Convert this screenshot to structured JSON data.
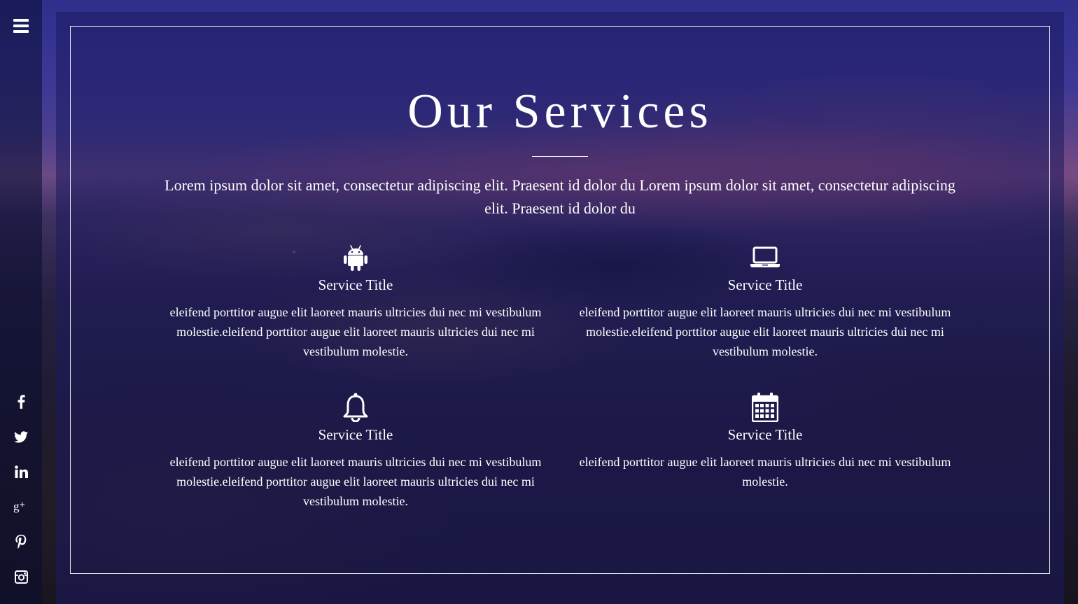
{
  "sidebar": {
    "menu_icon": "hamburger-menu-icon",
    "social": [
      {
        "name": "facebook",
        "icon": "facebook-icon"
      },
      {
        "name": "twitter",
        "icon": "twitter-icon"
      },
      {
        "name": "linkedin",
        "icon": "linkedin-icon"
      },
      {
        "name": "google-plus",
        "icon": "google-plus-icon"
      },
      {
        "name": "pinterest",
        "icon": "pinterest-icon"
      },
      {
        "name": "instagram",
        "icon": "instagram-icon"
      }
    ]
  },
  "main": {
    "title": "Our Services",
    "intro": "Lorem ipsum dolor sit amet, consectetur adipiscing elit. Praesent id dolor du Lorem ipsum dolor sit amet, consectetur adipiscing elit. Praesent id dolor du",
    "services": [
      {
        "icon": "android-icon",
        "title": "Service Title",
        "description": "eleifend porttitor augue elit laoreet mauris ultricies dui nec mi vestibulum molestie.eleifend porttitor augue elit laoreet mauris ultricies dui nec mi vestibulum molestie."
      },
      {
        "icon": "laptop-icon",
        "title": "Service Title",
        "description": "eleifend porttitor augue elit laoreet mauris ultricies dui nec mi vestibulum molestie.eleifend porttitor augue elit laoreet mauris ultricies dui nec mi vestibulum molestie."
      },
      {
        "icon": "bell-icon",
        "title": "Service Title",
        "description": "eleifend porttitor augue elit laoreet mauris ultricies dui nec mi vestibulum molestie.eleifend porttitor augue elit laoreet mauris ultricies dui nec mi vestibulum molestie."
      },
      {
        "icon": "calendar-icon",
        "title": "Service Title",
        "description": "eleifend porttitor augue elit laoreet mauris ultricies dui nec mi vestibulum molestie."
      }
    ]
  },
  "colors": {
    "text": "#ffffff",
    "panel_overlay": "#1c195f",
    "sidebar_overlay": "#0a0c32"
  }
}
